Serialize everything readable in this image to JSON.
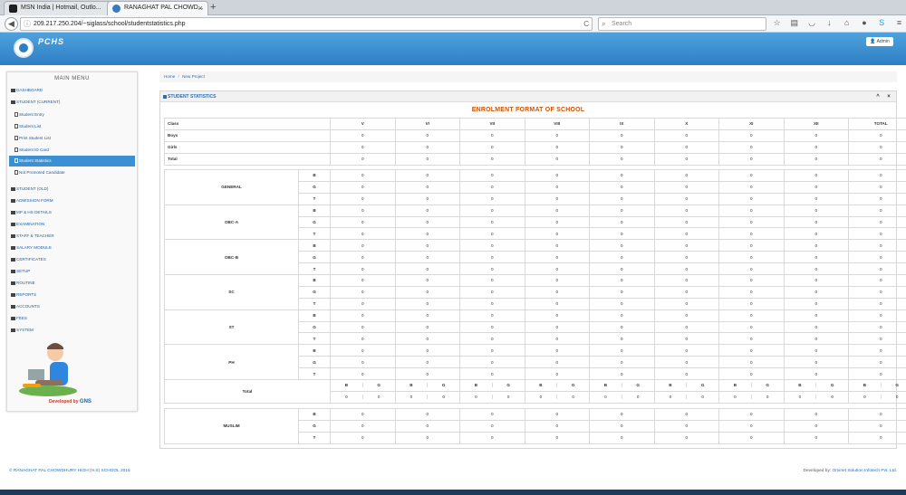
{
  "browser": {
    "tabs": [
      {
        "title": "MSN India | Hotmail, Outlo...",
        "active": false,
        "favicon_color": "#1f1f1f"
      },
      {
        "title": "RANAGHAT PAL CHOWD...",
        "active": true,
        "favicon_color": "#3b78c4"
      }
    ],
    "new_tab_symbol": "+",
    "close_symbol": "×",
    "back_symbol": "◀",
    "url": "209.217.250.204/~siglass/school/studentstatistics.php",
    "reload_symbol": "C",
    "search_placeholder": "Search",
    "toolbar_icons": [
      "star-icon",
      "clipboard-icon",
      "pocket-icon",
      "download-icon",
      "home-icon",
      "chat-icon",
      "skype-icon",
      "menu-icon"
    ]
  },
  "header": {
    "logo_text": "PCHS",
    "admin_label": "Admin",
    "color": "#3a8fd3"
  },
  "sidebar": {
    "title": "MAIN MENU",
    "items": [
      {
        "label": "DASHBOARD",
        "type": "main"
      },
      {
        "label": "STUDENT (CURRENT)",
        "type": "main"
      },
      {
        "label": "Student Entry",
        "type": "sub"
      },
      {
        "label": "Student List",
        "type": "sub"
      },
      {
        "label": "Print Student List",
        "type": "sub"
      },
      {
        "label": "Student ID Card",
        "type": "sub"
      },
      {
        "label": "Student Statistics",
        "type": "sub",
        "active": true
      },
      {
        "label": "Not Promoted Candidate",
        "type": "sub"
      },
      {
        "label": "STUDENT (OLD)",
        "type": "main"
      },
      {
        "label": "ADMISSION FORM",
        "type": "main"
      },
      {
        "label": "MP & HS Details",
        "type": "main"
      },
      {
        "label": "EXAMINATION",
        "type": "main"
      },
      {
        "label": "STAFF & TEACHER",
        "type": "main"
      },
      {
        "label": "SALARY MODULE",
        "type": "main"
      },
      {
        "label": "CERTIFICATES",
        "type": "main"
      },
      {
        "label": "SETUP",
        "type": "main"
      },
      {
        "label": "ROUTINE",
        "type": "main"
      },
      {
        "label": "REPORTS",
        "type": "main"
      },
      {
        "label": "ACCOUNTS",
        "type": "main"
      },
      {
        "label": "FEES",
        "type": "main"
      },
      {
        "label": "SYSTEM",
        "type": "main"
      }
    ],
    "developed_by": "Developed by",
    "developer_logo": "GNS"
  },
  "breadcrumb": {
    "home": "Home",
    "separator": "/",
    "current": "New Project"
  },
  "panel": {
    "title": "STUDENT STATISTICS",
    "collapse_symbol": "^",
    "close_symbol": "×",
    "heading": "ENROLMENT FORMAT OF SCHOOL",
    "classes": [
      "V",
      "VI",
      "VII",
      "VIII",
      "IX",
      "X",
      "XI",
      "XII",
      "TOTAL"
    ],
    "summary_header": "Class",
    "summary_rows": [
      {
        "label": "Boys",
        "values": [
          "0",
          "0",
          "0",
          "0",
          "0",
          "0",
          "0",
          "0",
          "0"
        ]
      },
      {
        "label": "Girls",
        "values": [
          "0",
          "0",
          "0",
          "0",
          "0",
          "0",
          "0",
          "0",
          "0"
        ]
      },
      {
        "label": "Total",
        "values": [
          "0",
          "0",
          "0",
          "0",
          "0",
          "0",
          "0",
          "0",
          "0"
        ]
      }
    ],
    "sub_labels": [
      "B",
      "G",
      "T"
    ],
    "groups": [
      {
        "name": "GENERAL",
        "rows": [
          [
            "0",
            "0",
            "0",
            "0",
            "0",
            "0",
            "0",
            "0",
            "0"
          ],
          [
            "0",
            "0",
            "0",
            "0",
            "0",
            "0",
            "0",
            "0",
            "0"
          ],
          [
            "0",
            "0",
            "0",
            "0",
            "0",
            "0",
            "0",
            "0",
            "0"
          ]
        ]
      },
      {
        "name": "OBC-A",
        "rows": [
          [
            "0",
            "0",
            "0",
            "0",
            "0",
            "0",
            "0",
            "0",
            "0"
          ],
          [
            "0",
            "0",
            "0",
            "0",
            "0",
            "0",
            "0",
            "0",
            "0"
          ],
          [
            "0",
            "0",
            "0",
            "0",
            "0",
            "0",
            "0",
            "0",
            "0"
          ]
        ]
      },
      {
        "name": "OBC-B",
        "rows": [
          [
            "0",
            "0",
            "0",
            "0",
            "0",
            "0",
            "0",
            "0",
            "0"
          ],
          [
            "0",
            "0",
            "0",
            "0",
            "0",
            "0",
            "0",
            "0",
            "0"
          ],
          [
            "0",
            "0",
            "0",
            "0",
            "0",
            "0",
            "0",
            "0",
            "0"
          ]
        ]
      },
      {
        "name": "SC",
        "rows": [
          [
            "0",
            "0",
            "0",
            "0",
            "0",
            "0",
            "0",
            "0",
            "0"
          ],
          [
            "0",
            "0",
            "0",
            "0",
            "0",
            "0",
            "0",
            "0",
            "0"
          ],
          [
            "0",
            "0",
            "0",
            "0",
            "0",
            "0",
            "0",
            "0",
            "0"
          ]
        ]
      },
      {
        "name": "ST",
        "rows": [
          [
            "0",
            "0",
            "0",
            "0",
            "0",
            "0",
            "0",
            "0",
            "0"
          ],
          [
            "0",
            "0",
            "0",
            "0",
            "0",
            "0",
            "0",
            "0",
            "0"
          ],
          [
            "0",
            "0",
            "0",
            "0",
            "0",
            "0",
            "0",
            "0",
            "0"
          ]
        ]
      },
      {
        "name": "PH",
        "rows": [
          [
            "0",
            "0",
            "0",
            "0",
            "0",
            "0",
            "0",
            "0",
            "0"
          ],
          [
            "0",
            "0",
            "0",
            "0",
            "0",
            "0",
            "0",
            "0",
            "0"
          ],
          [
            "0",
            "0",
            "0",
            "0",
            "0",
            "0",
            "0",
            "0",
            "0"
          ]
        ]
      }
    ],
    "total_label": "Total",
    "total_sub_labels": [
      "B",
      "G"
    ],
    "total_values": [
      "0",
      "0",
      "0",
      "0",
      "0",
      "0",
      "0",
      "0",
      "0",
      "0",
      "0",
      "0",
      "0",
      "0",
      "0",
      "0",
      "0",
      "0"
    ],
    "muslim": {
      "name": "MUSLIM",
      "rows": [
        [
          "0",
          "0",
          "0",
          "0",
          "0",
          "0",
          "0",
          "0",
          "0"
        ],
        [
          "0",
          "0",
          "0",
          "0",
          "0",
          "0",
          "0",
          "0",
          "0"
        ],
        [
          "0",
          "0",
          "0",
          "0",
          "0",
          "0",
          "0",
          "0",
          "0"
        ]
      ]
    }
  },
  "footer": {
    "left": "© RANAGHAT PAL CHOWDHURY HIGH (H.S) SCHOOL 2015",
    "right_prefix": "Developed by:",
    "right_company": "Ominet Solution Infotech Pvt. Ltd."
  }
}
